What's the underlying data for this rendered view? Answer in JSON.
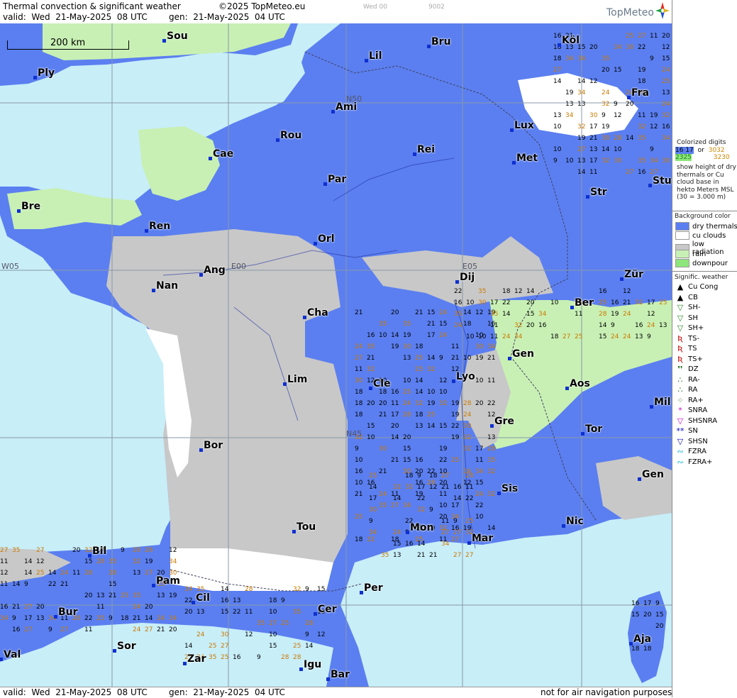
{
  "header": {
    "title": "Thermal convection & significant weather",
    "copyright": "©2025 TopMeteo.eu",
    "valid": "valid:  Wed  21-May-2025  08 UTC",
    "generated": "gen:  21-May-2025  04 UTC",
    "ghost1": "Wed 00",
    "ghost2": "9002",
    "logo": "TopMeteo"
  },
  "footer": {
    "valid": "valid:  Wed  21-May-2025  08 UTC",
    "generated": "gen:  21-May-2025  04 UTC",
    "disclaimer": "not for air navigation purposes"
  },
  "map": {
    "scale_label": "200 km",
    "grid_labels": [
      "N50",
      "N45",
      "E05",
      "E00",
      "W05"
    ],
    "cities": [
      "Sou",
      "Ply",
      "Lil",
      "Bru",
      "Köl",
      "Ami",
      "Fra",
      "Rou",
      "Cae",
      "Lux",
      "Rei",
      "Met",
      "Bre",
      "Par",
      "Stu",
      "Str",
      "Ren",
      "Orl",
      "Ang",
      "Dij",
      "Zür",
      "Nan",
      "Ber",
      "Cha",
      "Gen",
      "Aos",
      "Cle",
      "Lyo",
      "Lim",
      "Mil",
      "Gre",
      "Tor",
      "Bor",
      "Sis",
      "Gen",
      "Tou",
      "Mon",
      "Mar",
      "Nic",
      "Bil",
      "Pam",
      "Per",
      "Cil",
      "Cer",
      "Bur",
      "Sor",
      "Zar",
      "Aja",
      "Igu",
      "Val",
      "Bar"
    ],
    "sample_values": [
      "9",
      "10",
      "11",
      "12",
      "13",
      "14",
      "15",
      "16",
      "17",
      "18",
      "19",
      "20",
      "21",
      "22",
      "24",
      "25",
      "27",
      "28",
      "30",
      "32",
      "34",
      "35"
    ]
  },
  "legend": {
    "colorized_title": "Colorized digits",
    "example_a": "16  17",
    "example_b": "3032",
    "or": "or",
    "example_c": "2325",
    "example_d": "3230",
    "explanation": "show height of dry thermals or Cu cloud base in hekto Meters MSL (30 = 3.000 m)",
    "background_title": "Background color",
    "backgrounds": [
      {
        "label": "dry thermals",
        "color": "#5b7ff0"
      },
      {
        "label": "cu clouds",
        "color": "#ffffff"
      },
      {
        "label": "low radiation",
        "color": "#c8c8c8"
      },
      {
        "label": "rain",
        "color": "#c8f0b4"
      },
      {
        "label": "downpour",
        "color": "#8ce67a"
      }
    ],
    "weather_title": "Signific. weather",
    "weather": [
      {
        "sym": "▲",
        "label": "Cu Cong",
        "color": "#000000"
      },
      {
        "sym": "▲",
        "label": "CB",
        "color": "#000000"
      },
      {
        "sym": "▽",
        "label": "SH-",
        "color": "#228822"
      },
      {
        "sym": "▽",
        "label": "SH",
        "color": "#228822"
      },
      {
        "sym": "▽",
        "label": "SH+",
        "color": "#228822"
      },
      {
        "sym": "Ʀ",
        "label": "TS-",
        "color": "#cc0000"
      },
      {
        "sym": "Ʀ",
        "label": "TS",
        "color": "#cc0000"
      },
      {
        "sym": "Ʀ",
        "label": "TS+",
        "color": "#cc0000"
      },
      {
        "sym": "❜❜",
        "label": "DZ",
        "color": "#116611"
      },
      {
        "sym": "∴",
        "label": "RA-",
        "color": "#116611"
      },
      {
        "sym": "∴",
        "label": "RA",
        "color": "#116611"
      },
      {
        "sym": "⁘",
        "label": "RA+",
        "color": "#116611"
      },
      {
        "sym": "*",
        "label": "SNRA",
        "color": "#cc00cc"
      },
      {
        "sym": "▽",
        "label": "SHSNRA",
        "color": "#cc00cc"
      },
      {
        "sym": "**",
        "label": "SN",
        "color": "#0000cc"
      },
      {
        "sym": "▽",
        "label": "SHSN",
        "color": "#0000cc"
      },
      {
        "sym": "∾",
        "label": "FZRA",
        "color": "#22bbdd"
      },
      {
        "sym": "∾",
        "label": "FZRA+",
        "color": "#22bbdd"
      }
    ]
  }
}
